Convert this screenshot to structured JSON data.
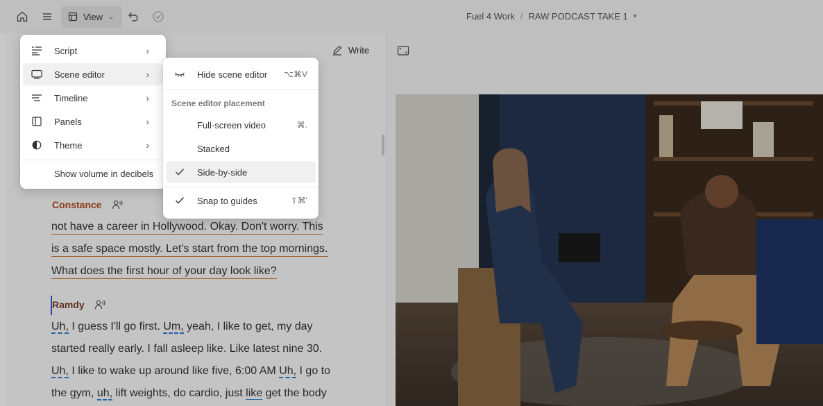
{
  "topbar": {
    "view_label": "View",
    "breadcrumb": {
      "project": "Fuel 4 Work",
      "separator": "/",
      "file": "RAW PODCAST TAKE 1"
    }
  },
  "script": {
    "write_label": "Write",
    "speaker1": {
      "name": "Constance",
      "color": "#b24a1e"
    },
    "speaker1_lines": [
      "not have a career in Hollywood. Okay. Don't worry. This",
      "is a safe space mostly. Let's start from the top mornings.",
      "What does the first hour of your day look like?"
    ],
    "speaker2": {
      "name": "Ramdy",
      "color": "#7a3f2a"
    },
    "speaker2_lines": [
      {
        "segments": [
          {
            "t": "Uh,",
            "filler": true
          },
          {
            "t": " I guess I'll go first. "
          },
          {
            "t": "Um,",
            "filler": true
          },
          {
            "t": " yeah, I like to get, my day"
          }
        ]
      },
      {
        "segments": [
          {
            "t": "started really early. I fall asleep like. Like latest nine 30."
          }
        ]
      },
      {
        "segments": [
          {
            "t": "Uh,",
            "filler": true
          },
          {
            "t": " I like to wake up around like five, 6:00 AM "
          },
          {
            "t": "Uh,",
            "filler": true
          },
          {
            "t": " I go to"
          }
        ]
      },
      {
        "segments": [
          {
            "t": "the gym, "
          },
          {
            "t": "uh,",
            "filler": true
          },
          {
            "t": " lift weights, do cardio, just "
          },
          {
            "t": "like",
            "filler": true
          },
          {
            "t": " get the body"
          }
        ]
      }
    ]
  },
  "view_menu": {
    "items": [
      {
        "label": "Script",
        "icon": "script-icon",
        "has_submenu": true
      },
      {
        "label": "Scene editor",
        "icon": "scene-editor-icon",
        "has_submenu": true,
        "active": true
      },
      {
        "label": "Timeline",
        "icon": "timeline-icon",
        "has_submenu": true
      },
      {
        "label": "Panels",
        "icon": "panels-icon",
        "has_submenu": true
      },
      {
        "label": "Theme",
        "icon": "theme-icon",
        "has_submenu": true
      }
    ],
    "footer_item": "Show volume in decibels"
  },
  "scene_submenu": {
    "hide": {
      "label": "Hide scene editor",
      "shortcut": "⌥⌘V"
    },
    "heading": "Scene editor placement",
    "placements": [
      {
        "label": "Full-screen video",
        "shortcut": "⌘.",
        "checked": false
      },
      {
        "label": "Stacked",
        "shortcut": "",
        "checked": false
      },
      {
        "label": "Side-by-side",
        "shortcut": "",
        "checked": true
      }
    ],
    "snap": {
      "label": "Snap to guides",
      "shortcut": "⇧⌘'",
      "checked": true
    }
  },
  "colors": {
    "accent": "#3b5bdb",
    "filler_underline": "#2f7bd8",
    "speaker_underline": "#c87a3a"
  }
}
